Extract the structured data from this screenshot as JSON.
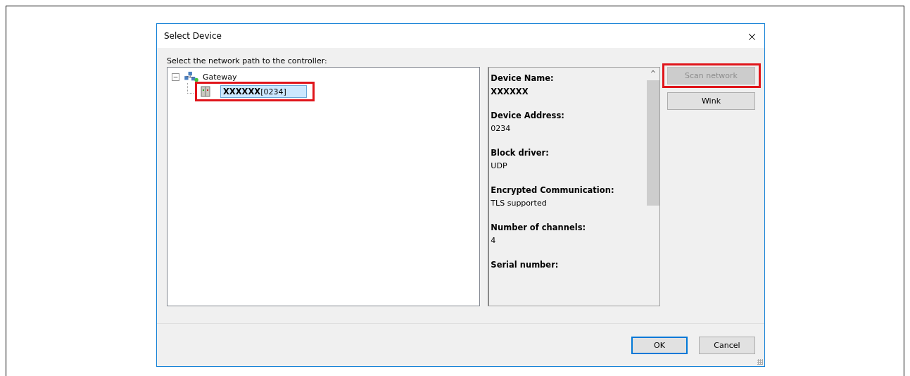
{
  "window": {
    "title": "Select Device",
    "close": "×"
  },
  "prompt": "Select the network path to the controller:",
  "tree": [
    {
      "label": "Gateway",
      "kind": "gateway",
      "expanded": true,
      "expander": "−",
      "selected": false,
      "highlighted": false,
      "children": [
        {
          "label": "XXXXXX",
          "suffix": "[0234]",
          "kind": "controller",
          "selected": true,
          "highlighted": true
        }
      ]
    }
  ],
  "details": [
    {
      "label": "Device Name:",
      "value": "XXXXXX",
      "bold_value": true
    },
    {
      "label": "Device Address:",
      "value": "0234",
      "bold_value": false
    },
    {
      "label": "Block driver:",
      "value": "UDP",
      "bold_value": false
    },
    {
      "label": "Encrypted Communication:",
      "value": "TLS supported",
      "bold_value": false
    },
    {
      "label": "Number of channels:",
      "value": "4",
      "bold_value": false
    },
    {
      "label": "Serial number:"
    }
  ],
  "scroll_up": "^",
  "side_buttons": [
    {
      "label": "Scan network",
      "disabled": true,
      "highlighted": true
    },
    {
      "label": "Wink",
      "disabled": false,
      "highlighted": false
    }
  ],
  "footer_buttons": [
    {
      "label": "OK",
      "default": true
    },
    {
      "label": "Cancel",
      "default": false
    }
  ]
}
